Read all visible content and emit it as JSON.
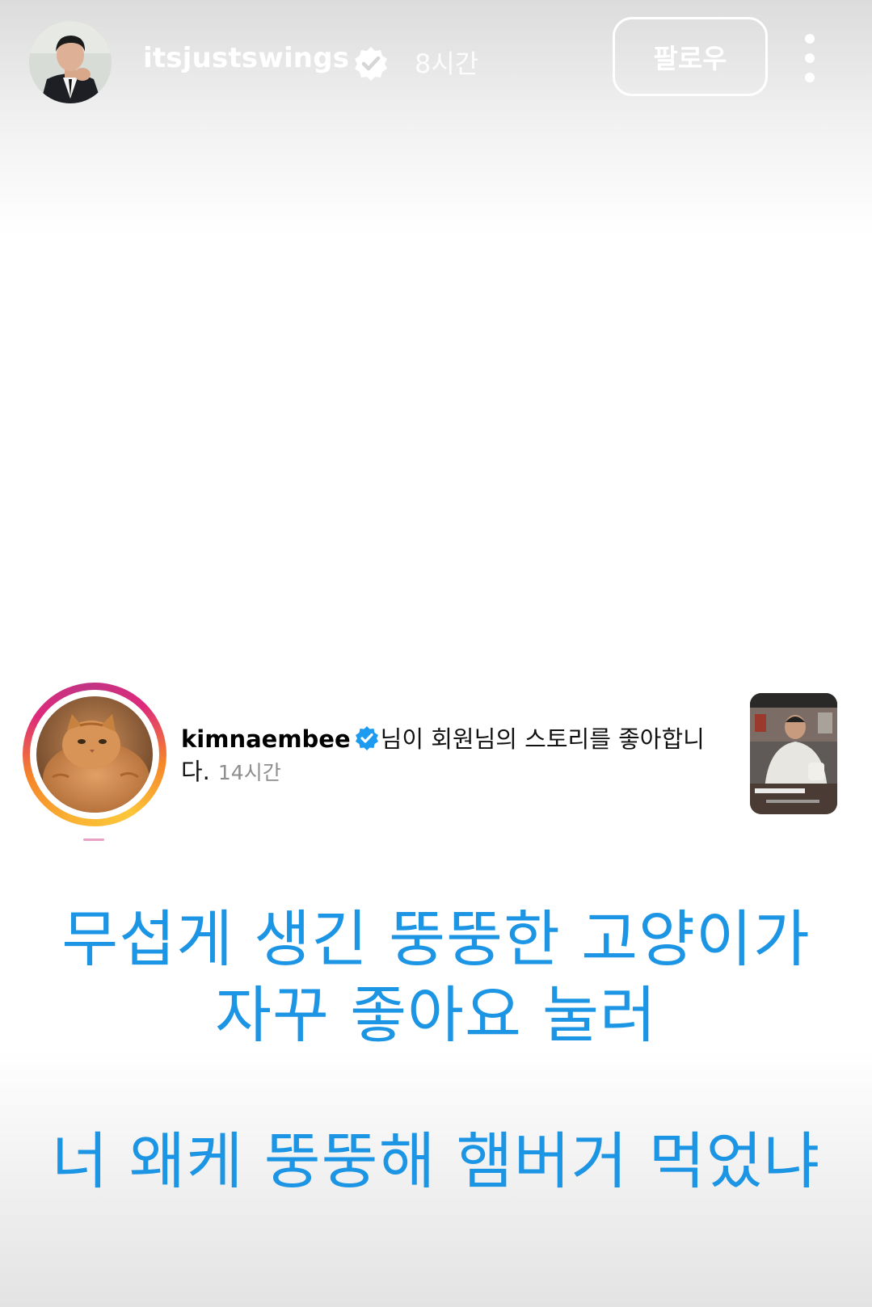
{
  "header": {
    "username": "itsjustswings",
    "time": "8시간",
    "follow_label": "팔로우"
  },
  "notification": {
    "username": "kimnaembee",
    "message": "님이 회원님의 스토리를 좋아합니다.",
    "time": "14시간"
  },
  "caption": {
    "line1": "무섭게 생긴 뚱뚱한 고양이가",
    "line2": "자꾸 좋아요 눌러",
    "line3": "너 왜케 뚱뚱해 햄버거 먹었냐"
  },
  "icons": {
    "verified_top": "verified-badge-icon",
    "verified_inline": "verified-badge-icon",
    "more": "more-vertical-icon"
  },
  "colors": {
    "caption": "#1c95e5",
    "verified_blue": "#1d9bf0",
    "ring_start": "#f9b233",
    "ring_end": "#c13584"
  }
}
